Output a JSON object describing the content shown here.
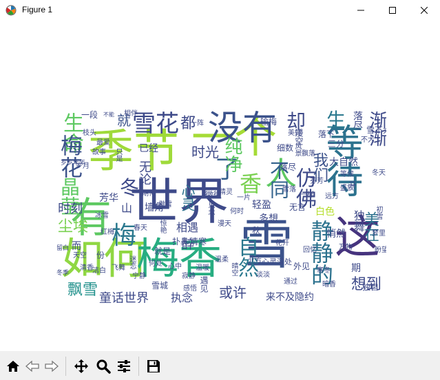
{
  "window": {
    "title": "Figure 1",
    "minimize": "–",
    "maximize": "☐",
    "close": "✕"
  },
  "toolbar": {
    "buttons": [
      {
        "name": "home-button",
        "icon": "home-icon"
      },
      {
        "name": "back-button",
        "icon": "arrow-left-icon"
      },
      {
        "name": "forward-button",
        "icon": "arrow-right-icon"
      },
      {
        "name": "pan-button",
        "icon": "move-icon"
      },
      {
        "name": "zoom-button",
        "icon": "magnifier-icon"
      },
      {
        "name": "subplots-button",
        "icon": "sliders-icon"
      },
      {
        "name": "save-button",
        "icon": "floppy-disk-icon"
      }
    ]
  },
  "wordcloud": {
    "words": [
      {
        "text": "雪",
        "color": "#3b528b"
      },
      {
        "text": "世界",
        "color": "#3e4a89"
      },
      {
        "text": "季节",
        "color": "#9fda3a"
      },
      {
        "text": "一个",
        "color": "#a5db36"
      },
      {
        "text": "等待",
        "color": "#2c728e"
      },
      {
        "text": "如何",
        "color": "#90d743"
      },
      {
        "text": "梅香",
        "color": "#27ad81"
      },
      {
        "text": "没有",
        "color": "#3b528b"
      },
      {
        "text": "有",
        "color": "#5ec962"
      },
      {
        "text": "这",
        "color": "#46337e"
      },
      {
        "text": "雪花",
        "color": "#3e4a89"
      },
      {
        "text": "人",
        "color": "#5ec962"
      },
      {
        "text": "静静的",
        "color": "#2c728e"
      },
      {
        "text": "生命",
        "color": "#5ec962"
      },
      {
        "text": "都",
        "color": "#3e4a89"
      },
      {
        "text": "却",
        "color": "#3e4a89"
      },
      {
        "text": "了",
        "color": "#355f8d"
      },
      {
        "text": "梅",
        "color": "#2a788e"
      },
      {
        "text": "香",
        "color": "#7ad151"
      },
      {
        "text": "自然",
        "color": "#2a788e"
      },
      {
        "text": "不同",
        "color": "#33638d"
      },
      {
        "text": "仿佛",
        "color": "#3e4a89"
      },
      {
        "text": "我们",
        "color": "#3b528b"
      },
      {
        "text": "生",
        "color": "#2a788e"
      },
      {
        "text": "渐渐",
        "color": "#3e4a89"
      },
      {
        "text": "晶莹",
        "color": "#5ec962"
      },
      {
        "text": "梅花",
        "color": "#3b528b"
      },
      {
        "text": "冬",
        "color": "#3e4a89"
      },
      {
        "text": "就",
        "color": "#3b528b"
      },
      {
        "text": "时光",
        "color": "#3e4a89"
      },
      {
        "text": "纯净",
        "color": "#5ec962"
      },
      {
        "text": "想到",
        "color": "#3e4a89"
      },
      {
        "text": "飘雪",
        "color": "#21918c"
      },
      {
        "text": "童话世界",
        "color": "#3e4a89"
      },
      {
        "text": "或许",
        "color": "#3e4a89"
      },
      {
        "text": "来不及隐约",
        "color": "#3e4a89"
      },
      {
        "text": "执念",
        "color": "#3e4a89"
      },
      {
        "text": "醉",
        "color": "#3e4a89"
      },
      {
        "text": "相遇",
        "color": "#3e4a89"
      },
      {
        "text": "时刻",
        "color": "#3e4a89"
      },
      {
        "text": "尘埃",
        "color": "#7ad151"
      },
      {
        "text": "独舞",
        "color": "#3e4a89"
      },
      {
        "text": "美在",
        "color": "#2c728e"
      },
      {
        "text": "白色",
        "color": "#b5de2b"
      },
      {
        "text": "多想",
        "color": "#3e4a89"
      },
      {
        "text": "轻盈",
        "color": "#3e4a89"
      },
      {
        "text": "心灵",
        "color": "#2c728e"
      },
      {
        "text": "无论",
        "color": "#3e4a89"
      },
      {
        "text": "芳华",
        "color": "#3e4a89"
      },
      {
        "text": "已经",
        "color": "#3e4a89"
      },
      {
        "text": "落尽",
        "color": "#3e4a89"
      },
      {
        "text": "墙角",
        "color": "#3e4a89"
      },
      {
        "text": "山",
        "color": "#3e4a89"
      },
      {
        "text": "悄然",
        "color": "#3e4a89"
      },
      {
        "text": "大自然",
        "color": "#3e4a89"
      },
      {
        "text": "落下",
        "color": "#3e4a89"
      },
      {
        "text": "三分",
        "color": "#3e4a89"
      },
      {
        "text": "漫空",
        "color": "#3e4a89"
      },
      {
        "text": "雪不大",
        "color": "#3e4a89"
      },
      {
        "text": "输梅",
        "color": "#3e4a89"
      },
      {
        "text": "细数",
        "color": "#3e4a89"
      },
      {
        "text": "落尽",
        "color": "#3e4a89"
      },
      {
        "text": "无言",
        "color": "#3e4a89"
      },
      {
        "text": "秋",
        "color": "#3e4a89"
      },
      {
        "text": "一段",
        "color": "#3e4a89"
      },
      {
        "text": "不能",
        "color": "#3e4a89"
      },
      {
        "text": "就是",
        "color": "#3e4a89"
      },
      {
        "text": "感悟",
        "color": "#3e4a89"
      },
      {
        "text": "雪城",
        "color": "#3e4a89"
      },
      {
        "text": "遇见",
        "color": "#3e4a89"
      },
      {
        "text": "外见",
        "color": "#3e4a89"
      },
      {
        "text": "通过",
        "color": "#3e4a89"
      },
      {
        "text": "期",
        "color": "#3e4a89"
      },
      {
        "text": "而",
        "color": "#3e4a89"
      },
      {
        "text": "份",
        "color": "#3e4a89"
      },
      {
        "text": "开",
        "color": "#3e4a89"
      },
      {
        "text": "盛放",
        "color": "#3e4a89"
      },
      {
        "text": "岁岁年年",
        "color": "#3e4a89"
      },
      {
        "text": "独自",
        "color": "#3e4a89"
      },
      {
        "text": "冬季",
        "color": "#3e4a89"
      },
      {
        "text": "留白",
        "color": "#3e4a89"
      },
      {
        "text": "扑鼻",
        "color": "#3e4a89"
      },
      {
        "text": "清寒",
        "color": "#3e4a89"
      },
      {
        "text": "微微",
        "color": "#3e4a89"
      },
      {
        "text": "一阵",
        "color": "#3e4a89"
      },
      {
        "text": "北方",
        "color": "#3e4a89"
      },
      {
        "text": "心灵深处",
        "color": "#3e4a89"
      },
      {
        "text": "美好",
        "color": "#3e4a89"
      },
      {
        "text": "不大",
        "color": "#3e4a89"
      },
      {
        "text": "相伴",
        "color": "#3e4a89"
      },
      {
        "text": "迷恋",
        "color": "#3e4a89"
      },
      {
        "text": "何处",
        "color": "#3e4a89"
      },
      {
        "text": "岁月",
        "color": "#3e4a89"
      },
      {
        "text": "故事",
        "color": "#3e4a89"
      },
      {
        "text": "只是",
        "color": "#3e4a89"
      },
      {
        "text": "最爱",
        "color": "#3e4a89"
      },
      {
        "text": "春天",
        "color": "#3e4a89"
      },
      {
        "text": "惊艳",
        "color": "#3e4a89"
      },
      {
        "text": "温暖",
        "color": "#3e4a89"
      },
      {
        "text": "风景",
        "color": "#3e4a89"
      },
      {
        "text": "飘落",
        "color": "#3e4a89"
      },
      {
        "text": "万物",
        "color": "#3e4a89"
      },
      {
        "text": "初雪",
        "color": "#3e4a89"
      },
      {
        "text": "盼望",
        "color": "#3e4a89"
      },
      {
        "text": "寒冬",
        "color": "#3e4a89"
      },
      {
        "text": "晴空",
        "color": "#3e4a89"
      },
      {
        "text": "精灵",
        "color": "#3e4a89"
      },
      {
        "text": "思念",
        "color": "#3e4a89"
      },
      {
        "text": "洁白",
        "color": "#3e4a89"
      },
      {
        "text": "飞舞",
        "color": "#3e4a89"
      },
      {
        "text": "天空",
        "color": "#3e4a89"
      },
      {
        "text": "枝头",
        "color": "#3e4a89"
      },
      {
        "text": "雪落",
        "color": "#3e4a89"
      },
      {
        "text": "一样",
        "color": "#3e4a89"
      },
      {
        "text": "一片",
        "color": "#3e4a89"
      },
      {
        "text": "何时",
        "color": "#3e4a89"
      },
      {
        "text": "花开",
        "color": "#3e4a89"
      },
      {
        "text": "心中",
        "color": "#3e4a89"
      },
      {
        "text": "寂静",
        "color": "#3e4a89"
      },
      {
        "text": "宁静",
        "color": "#3e4a89"
      },
      {
        "text": "清香",
        "color": "#3e4a89"
      },
      {
        "text": "梦里",
        "color": "#3e4a89"
      },
      {
        "text": "远方",
        "color": "#3e4a89"
      },
      {
        "text": "等候",
        "color": "#3e4a89"
      },
      {
        "text": "冬天",
        "color": "#3e4a89"
      },
      {
        "text": "芬芳",
        "color": "#3e4a89"
      },
      {
        "text": "温柔",
        "color": "#3e4a89"
      },
      {
        "text": "淡淡",
        "color": "#3e4a89"
      },
      {
        "text": "回忆",
        "color": "#3e4a89"
      },
      {
        "text": "暗香",
        "color": "#3e4a89"
      },
      {
        "text": "期待",
        "color": "#3e4a89"
      },
      {
        "text": "傲雪",
        "color": "#3e4a89"
      },
      {
        "text": "冰雪",
        "color": "#3e4a89"
      },
      {
        "text": "红梅",
        "color": "#3e4a89"
      },
      {
        "text": "漫天",
        "color": "#3e4a89"
      }
    ]
  }
}
